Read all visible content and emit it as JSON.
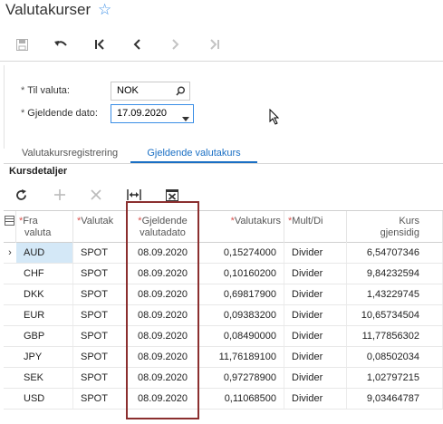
{
  "page": {
    "title": "Valutakurser"
  },
  "form": {
    "til_valuta_label": "Til valuta:",
    "til_valuta_value": "NOK",
    "dato_label": "Gjeldende dato:",
    "dato_value": "17.09.2020"
  },
  "tabs": [
    {
      "label": "Valutakursregistrering"
    },
    {
      "label": "Gjeldende valutakurs"
    }
  ],
  "section": {
    "title": "Kursdetaljer"
  },
  "grid": {
    "columns": [
      {
        "label_line1": "Fra",
        "label_line2": "valuta",
        "required": "*"
      },
      {
        "label_line1": "Valutak",
        "label_line2": "",
        "required": "*"
      },
      {
        "label_line1": "Gjeldende",
        "label_line2": "valutadato",
        "required": "*"
      },
      {
        "label_line1": "Valutakurs",
        "label_line2": "",
        "required": "*"
      },
      {
        "label_line1": "Mult/Di",
        "label_line2": "",
        "required": "*"
      },
      {
        "label_line1": "Kurs",
        "label_line2": "gjensidig",
        "required": ""
      }
    ],
    "rows": [
      {
        "from": "AUD",
        "type": "SPOT",
        "date": "08.09.2020",
        "rate": "0,15274000",
        "mult": "Divider",
        "recip": "6,54707346"
      },
      {
        "from": "CHF",
        "type": "SPOT",
        "date": "08.09.2020",
        "rate": "0,10160200",
        "mult": "Divider",
        "recip": "9,84232594"
      },
      {
        "from": "DKK",
        "type": "SPOT",
        "date": "08.09.2020",
        "rate": "0,69817900",
        "mult": "Divider",
        "recip": "1,43229745"
      },
      {
        "from": "EUR",
        "type": "SPOT",
        "date": "08.09.2020",
        "rate": "0,09383200",
        "mult": "Divider",
        "recip": "10,65734504"
      },
      {
        "from": "GBP",
        "type": "SPOT",
        "date": "08.09.2020",
        "rate": "0,08490000",
        "mult": "Divider",
        "recip": "11,77856302"
      },
      {
        "from": "JPY",
        "type": "SPOT",
        "date": "08.09.2020",
        "rate": "11,76189100",
        "mult": "Divider",
        "recip": "0,08502034"
      },
      {
        "from": "SEK",
        "type": "SPOT",
        "date": "08.09.2020",
        "rate": "0,97278900",
        "mult": "Divider",
        "recip": "1,02797215"
      },
      {
        "from": "USD",
        "type": "SPOT",
        "date": "08.09.2020",
        "rate": "0,11068500",
        "mult": "Divider",
        "recip": "9,03464787"
      }
    ]
  },
  "colors": {
    "accent": "#1a6fc4",
    "highlight_box": "#8b2f2f",
    "selected_cell": "#d4e8f7"
  },
  "icons": [
    "star-icon",
    "save-icon",
    "undo-icon",
    "first-icon",
    "prev-icon",
    "next-icon",
    "last-icon",
    "search-icon",
    "dropdown-icon",
    "refresh-icon",
    "add-icon",
    "delete-icon",
    "fit-columns-icon",
    "export-icon",
    "grid-settings-icon",
    "row-selector-icon"
  ]
}
